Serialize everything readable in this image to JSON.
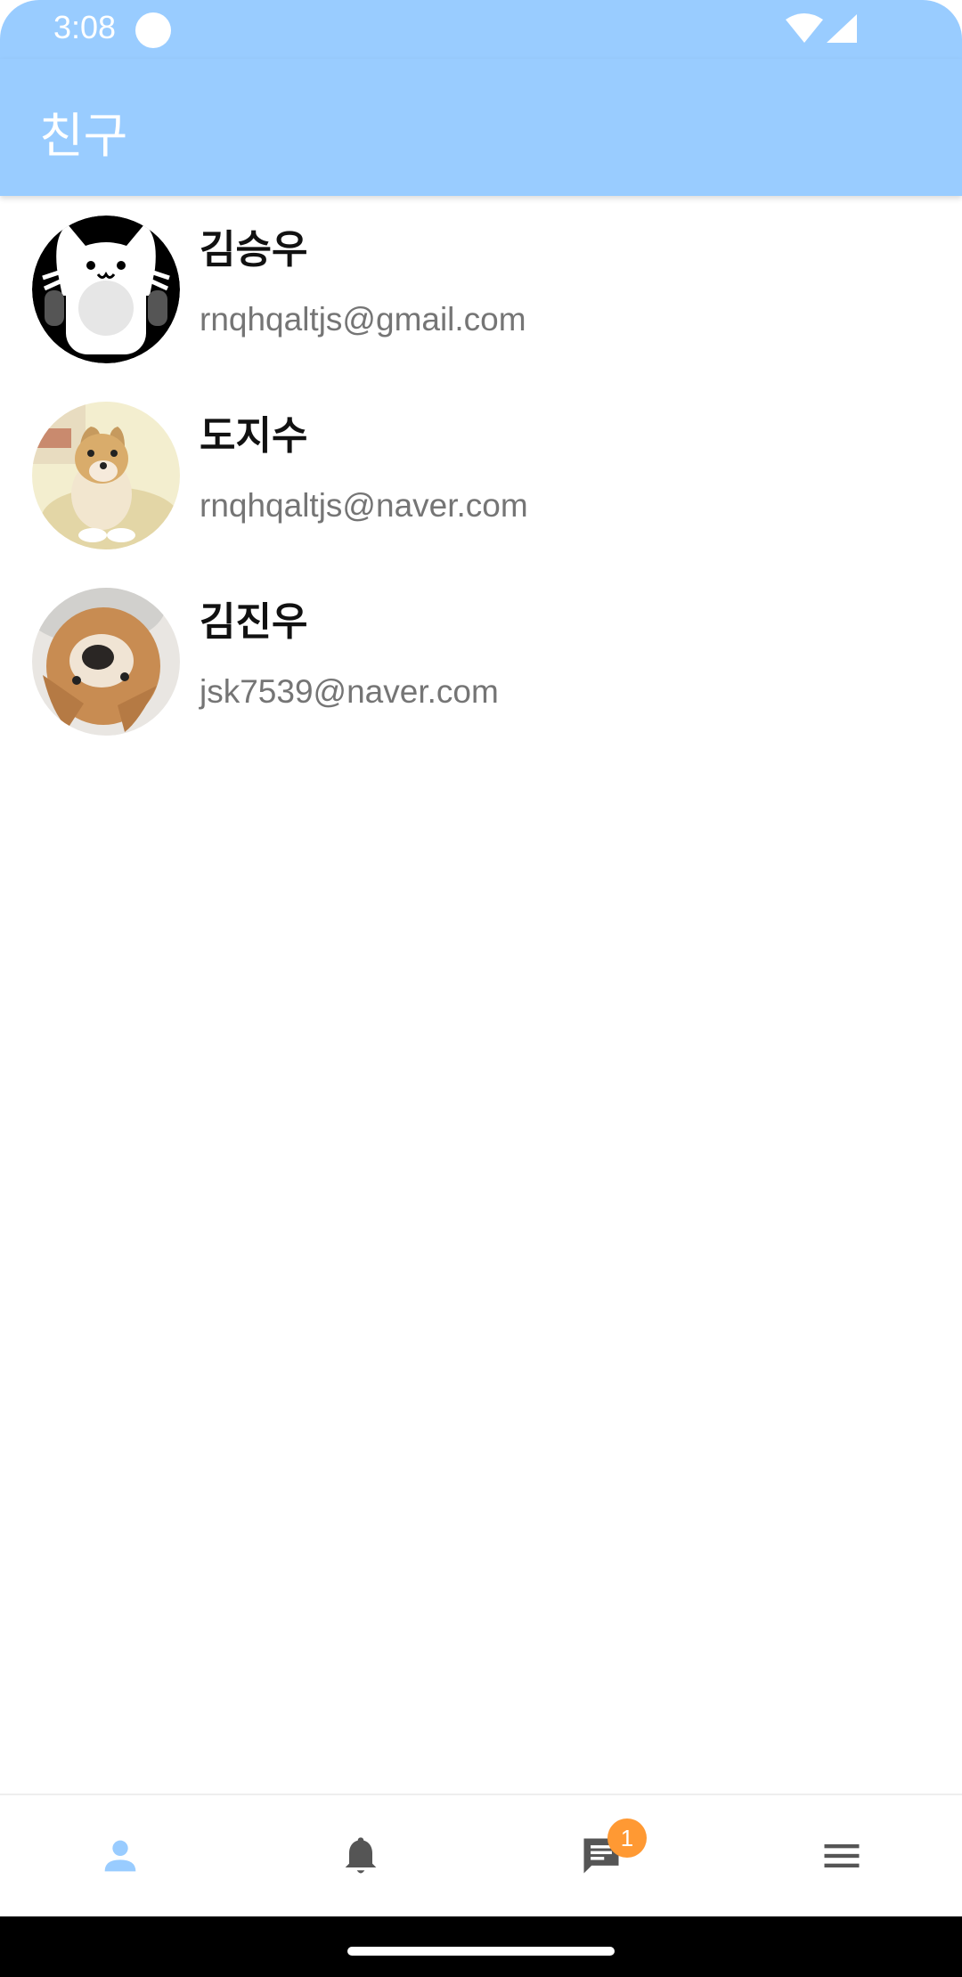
{
  "status_bar": {
    "time": "3:08",
    "icons": [
      "notification-dot-icon",
      "wifi-icon",
      "cellular-signal-icon"
    ]
  },
  "app_bar": {
    "title": "친구",
    "color": "#99ccff"
  },
  "friends": [
    {
      "name": "김승우",
      "email": "rnqhqaltjs@gmail.com",
      "avatar": "cartoon-cat-avatar"
    },
    {
      "name": "도지수",
      "email": "rnqhqaltjs@naver.com",
      "avatar": "shiba-dog-avatar"
    },
    {
      "name": "김진우",
      "email": "jsk7539@naver.com",
      "avatar": "upside-down-shiba-avatar"
    }
  ],
  "bottom_nav": {
    "items": [
      {
        "icon": "person-icon",
        "active": true
      },
      {
        "icon": "bell-icon",
        "active": false
      },
      {
        "icon": "chat-icon",
        "active": false,
        "badge": "1"
      },
      {
        "icon": "menu-icon",
        "active": false
      }
    ],
    "active_color": "#99ccff",
    "inactive_color": "#555555",
    "badge_color": "#ff9933"
  }
}
